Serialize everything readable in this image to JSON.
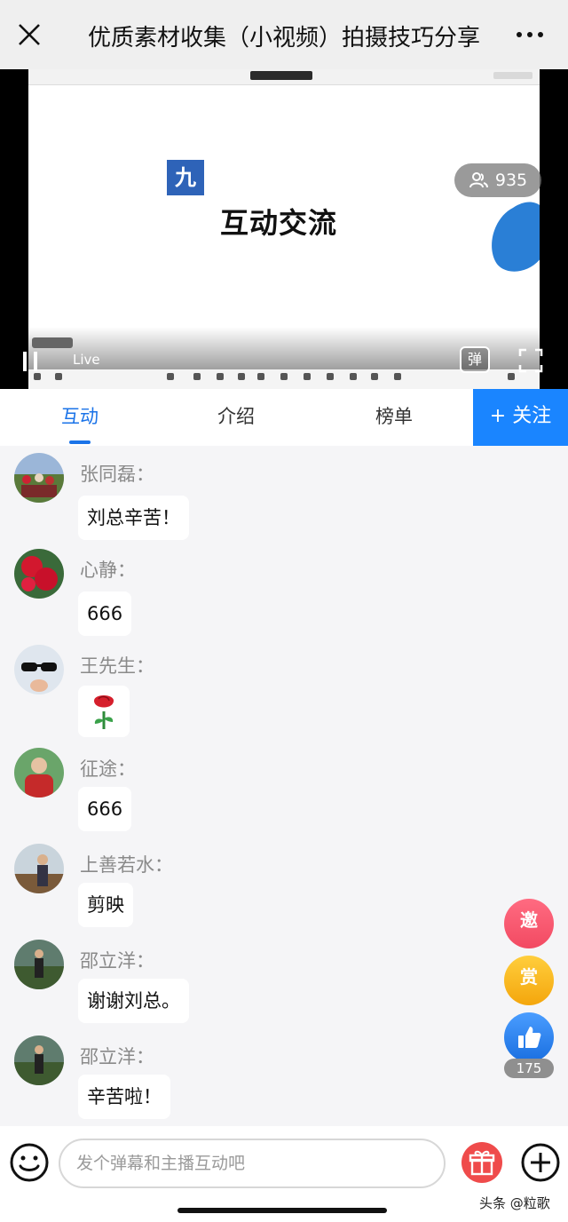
{
  "header": {
    "title": "优质素材收集（小视频）拍摄技巧分享",
    "close_icon": "close-icon",
    "more_icon": "more-icon"
  },
  "player": {
    "viewer_count": "935",
    "section_number": "九",
    "slide_heading": "互动交流",
    "live_label": "Live",
    "danmaku_label": "弹"
  },
  "tabs": [
    {
      "label": "互动",
      "active": true
    },
    {
      "label": "介绍",
      "active": false
    },
    {
      "label": "榜单",
      "active": false
    }
  ],
  "follow_label": "+ 关注",
  "messages": [
    {
      "user": "张同磊：",
      "text": "刘总辛苦！",
      "avatar": "crowd"
    },
    {
      "user": "心静：",
      "text": "666",
      "avatar": "flowers"
    },
    {
      "user": "王先生：",
      "text": "",
      "emoji": "rose",
      "avatar": "sunglasses"
    },
    {
      "user": "征途：",
      "text": "666",
      "avatar": "person-red"
    },
    {
      "user": "上善若水：",
      "text": "剪映",
      "avatar": "person-outdoor"
    },
    {
      "user": "邵立洋：",
      "text": "谢谢刘总。",
      "avatar": "greenhouse"
    },
    {
      "user": "邵立洋：",
      "text": "辛苦啦！",
      "avatar": "greenhouse"
    }
  ],
  "actions": {
    "invite_label": "邀",
    "reward_label": "赏",
    "like_count": "175"
  },
  "input": {
    "placeholder": "发个弹幕和主播互动吧"
  },
  "watermark": "头条 @粒歌",
  "colors": {
    "accent": "#1a73e8",
    "follow_bg": "#1a85ff",
    "invite": "#f24a62",
    "reward": "#f4a60c",
    "like": "#1a6fe0",
    "gift": "#ef4b4b"
  }
}
